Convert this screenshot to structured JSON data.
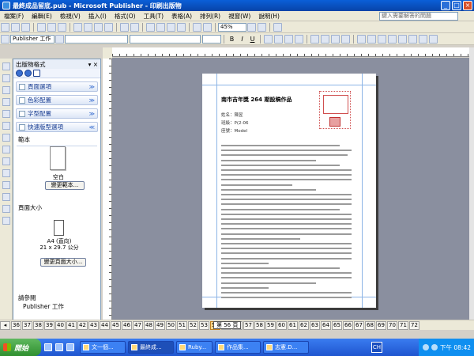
{
  "window": {
    "title": "最終成品留底.pub - Microsoft Publisher - 印刷出版物"
  },
  "menu": {
    "items": [
      "檔案(F)",
      "編輯(E)",
      "檢視(V)",
      "插入(I)",
      "格式(O)",
      "工具(T)",
      "表格(A)",
      "排列(R)",
      "視窗(W)",
      "說明(H)"
    ],
    "help_placeholder": "鍵入需要解答的問題"
  },
  "toolbar": {
    "zoom": "45%",
    "style_combo": "Publisher 工作",
    "bold": "B",
    "italic": "I",
    "underline": "U"
  },
  "taskpane": {
    "title": "出版物格式",
    "sections": [
      "頁面選項",
      "色彩配置",
      "字型配置",
      "快速版型選項"
    ],
    "template_label": "範本",
    "template_name": "空白",
    "change_template_button": "變更範本...",
    "page_size_label": "頁面大小",
    "page_size_name": "A4 (直向)",
    "page_size_dims": "21 x 29.7 公分",
    "change_size_button": "變更頁面大小...",
    "see_also_label": "請參閱",
    "see_also_link": "Publisher 工作"
  },
  "document": {
    "title": "南市吉年獎 264 期設稿作品",
    "class_line": "姓名：陳昱",
    "no_line": "班級：P(2-06",
    "teacher_line": "座號：Model"
  },
  "pagenav": {
    "pages": [
      "36",
      "37",
      "38",
      "39",
      "40",
      "41",
      "42",
      "43",
      "44",
      "45",
      "46",
      "47",
      "48",
      "49",
      "50",
      "51",
      "52",
      "53",
      "54",
      "55",
      "56",
      "57",
      "58",
      "59",
      "60",
      "61",
      "62",
      "63",
      "64",
      "65",
      "66",
      "67",
      "68",
      "69",
      "70",
      "71",
      "72"
    ],
    "current": "54",
    "indicator": "第 56 頁"
  },
  "taskbar": {
    "start_label": "開始",
    "tasks": [
      "文一個...",
      "最終成...",
      "Ruby...",
      "作品集...",
      "志憲.D..."
    ],
    "active_task_index": 1,
    "lang": "CH",
    "clock": "下午 08:42"
  }
}
